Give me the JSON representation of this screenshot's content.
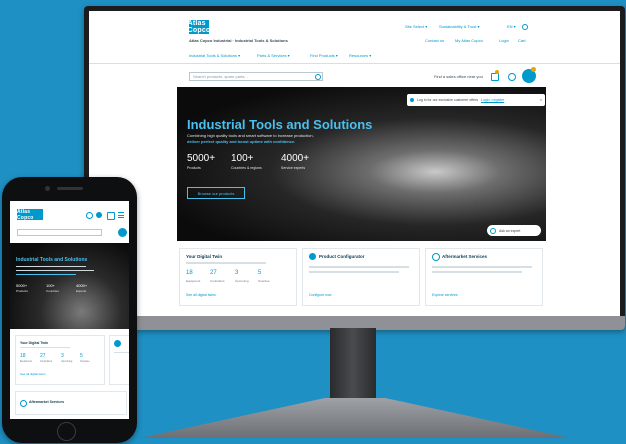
{
  "site": {
    "logo_text": "Atlas Copco",
    "tagline": "Atlas Copco Industrial · Industrial Tools & Solutions",
    "top_links": [
      "Site Select ▾",
      "Sustainability & Trust ▾",
      "EN ▾"
    ],
    "util_links": [
      "Contact us",
      "My Atlas Copco",
      "Login",
      "Cart"
    ],
    "nav": [
      "Industrial Tools & Solutions ▾",
      "Parts & Services ▾",
      "Find Products ▾",
      "Resources ▾"
    ],
    "search_placeholder": "Search products, spare parts...",
    "dealer_label": "Find a sales office near you",
    "hero": {
      "title": "Industrial Tools and Solutions",
      "sub1": "Combining high quality tools and smart software to increase production,",
      "sub2": "deliver perfect quality and boost uptime with confidence.",
      "stats": [
        {
          "value": "5000+",
          "label": "Products"
        },
        {
          "value": "100+",
          "label": "Countries & regions"
        },
        {
          "value": "4000+",
          "label": "Service experts"
        }
      ],
      "button": "Browse our products",
      "chat": "Ask an expert"
    },
    "toast": {
      "text": "Log in for our exclusive customer offers",
      "link": "Login / register"
    },
    "cards": [
      {
        "title": "Your Digital Twin",
        "numbers": [
          {
            "v": "18",
            "l": "Equipment"
          },
          {
            "v": "27",
            "l": "Controllers"
          },
          {
            "v": "3",
            "l": "Upcoming"
          },
          {
            "v": "5",
            "l": "Overdue"
          }
        ],
        "link": "See all digital twins"
      },
      {
        "title": "Product Configurator",
        "link": "Configure now"
      },
      {
        "title": "Aftermarket Services",
        "link": "Explore services"
      }
    ]
  },
  "mobile": {
    "logo_text": "Atlas Copco",
    "hero_title": "Industrial Tools and Solutions",
    "stats": [
      {
        "value": "5000+",
        "label": "Products"
      },
      {
        "value": "100+",
        "label": "Countries"
      },
      {
        "value": "4000+",
        "label": "Experts"
      }
    ],
    "card_title": "Your Digital Twin",
    "numbers": [
      {
        "v": "18",
        "l": "Equipment"
      },
      {
        "v": "27",
        "l": "Controllers"
      },
      {
        "v": "3",
        "l": "Upcoming"
      },
      {
        "v": "5",
        "l": "Overdue"
      }
    ],
    "card_link": "See all digital twins",
    "bottom_title": "Aftermarket Services"
  },
  "colors": {
    "brand": "#0099cc",
    "background": "#1f90c4"
  }
}
